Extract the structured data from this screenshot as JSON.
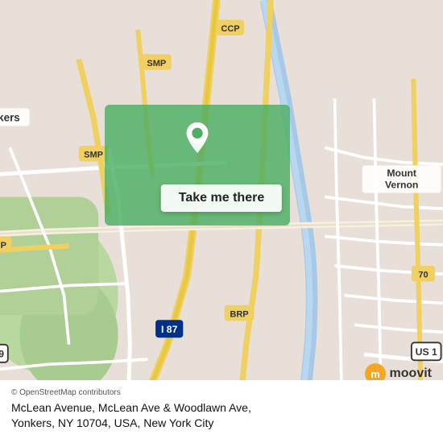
{
  "map": {
    "copyright": "© OpenStreetMap contributors",
    "alt": "Map of Yonkers and Mount Vernon area, New York"
  },
  "card": {
    "address": "McLean Avenue, McLean Ave & Woodlawn Ave,\nYonkers, NY 10704, USA, New York City"
  },
  "button": {
    "label": "Take me there"
  },
  "moovit": {
    "label": "moovit"
  },
  "colors": {
    "green_overlay": "#4caf64",
    "road_major": "#f5e9a0",
    "road_minor": "#ffffff",
    "map_bg": "#e8e0d8",
    "green_area": "#b8d8a0",
    "water": "#a8c8e8"
  }
}
